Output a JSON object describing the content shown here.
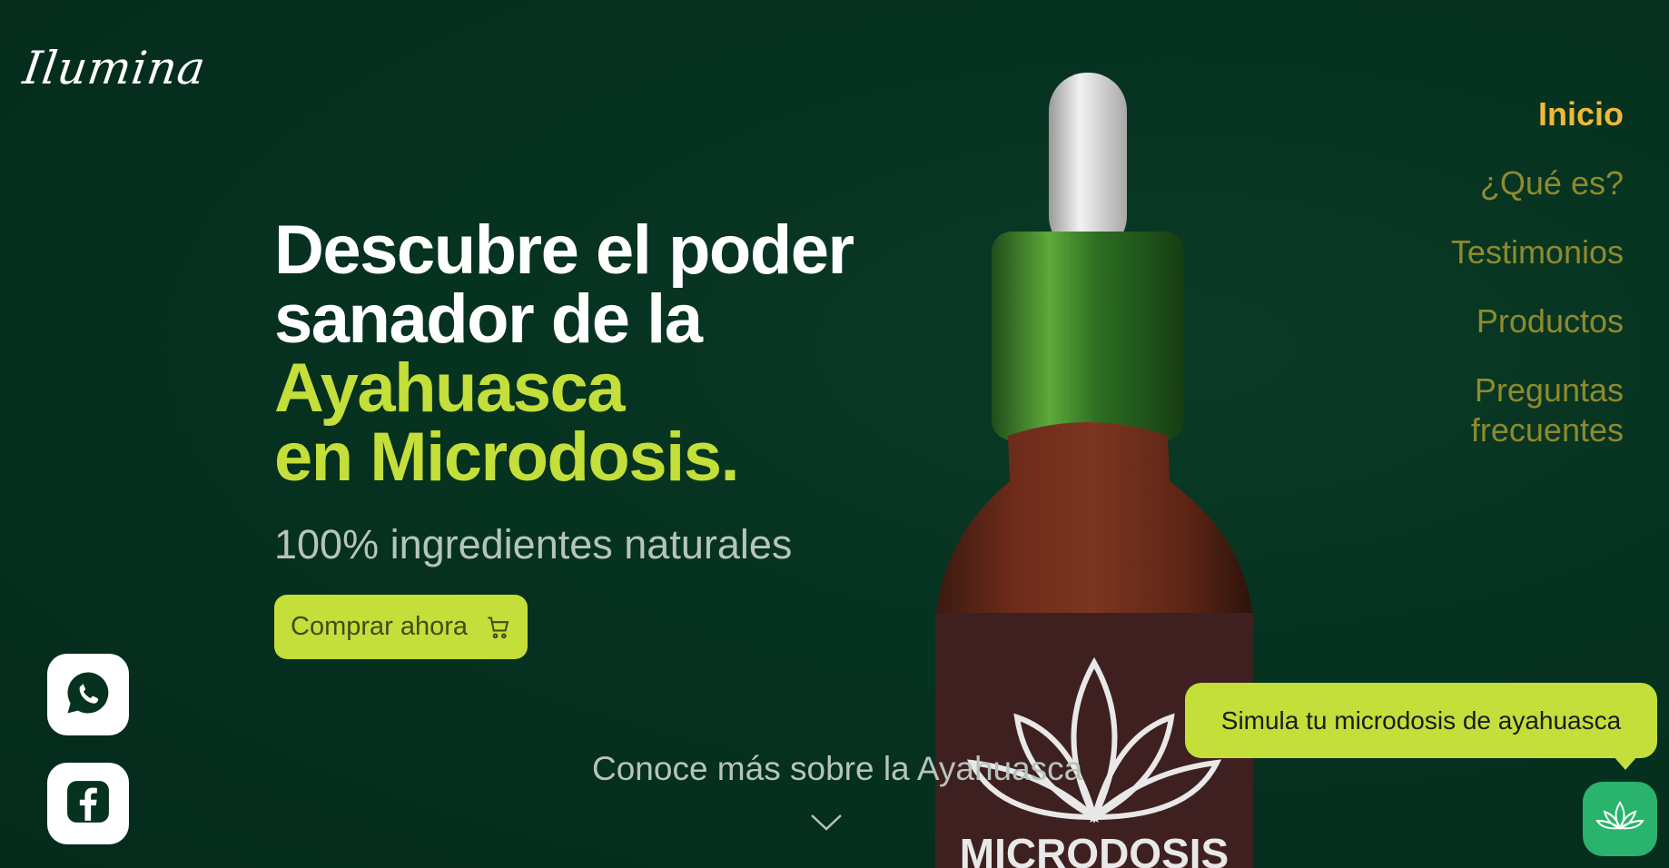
{
  "brand": {
    "logo_text": "Ilumina"
  },
  "nav": {
    "items": [
      {
        "label": "Inicio",
        "active": true
      },
      {
        "label": "¿Qué es?"
      },
      {
        "label": "Testimonios"
      },
      {
        "label": "Productos"
      },
      {
        "label": "Preguntas frecuentes"
      }
    ]
  },
  "hero": {
    "line1": "Descubre el poder",
    "line2": "sanador de la",
    "line3": "Ayahuasca",
    "line4": "en Microdosis.",
    "subtitle": "100% ingredientes naturales",
    "cta_label": "Comprar ahora"
  },
  "product": {
    "label_text": "MICRODOSIS"
  },
  "footer_cta": {
    "learn_more": "Conoce más sobre la Ayahuasca"
  },
  "chat": {
    "bubble_text": "Simula tu microdosis de ayahuasca"
  },
  "colors": {
    "background": "#063220",
    "accent_lime": "#c4de3a",
    "nav_active": "#f0b83a",
    "nav_inactive": "#8f8a2c",
    "chat_button": "#29b36c"
  },
  "icons": [
    "cart-icon",
    "whatsapp-icon",
    "facebook-icon",
    "chevron-down-icon",
    "lotus-icon"
  ]
}
